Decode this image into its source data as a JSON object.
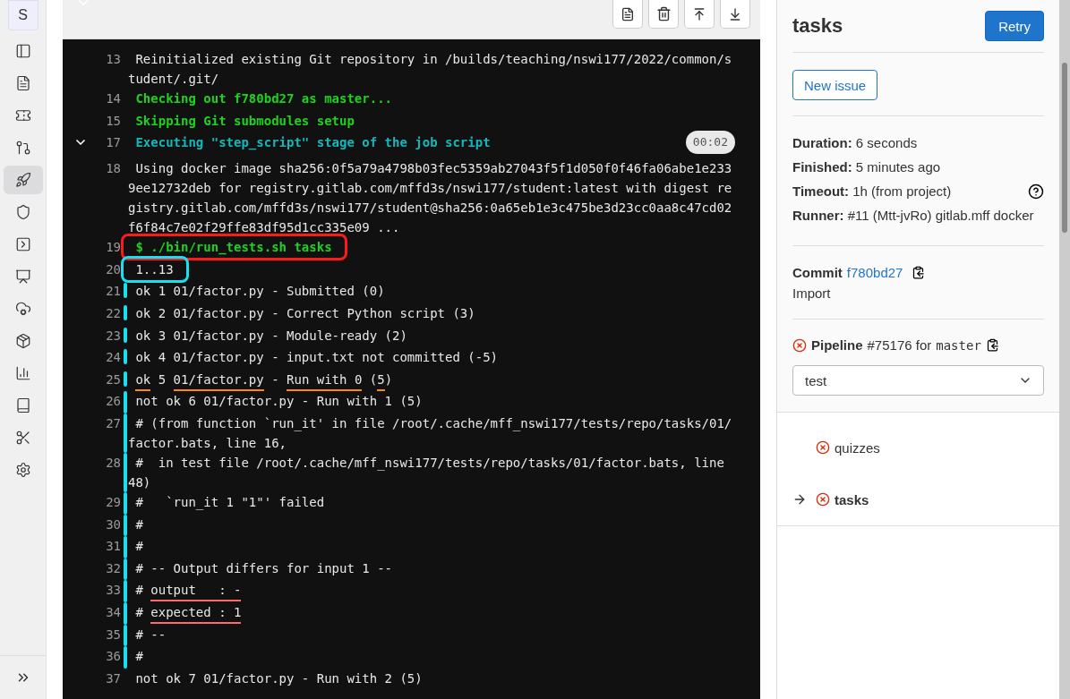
{
  "sidebar": {
    "avatar": "S",
    "items": [
      {
        "selected": false
      },
      {
        "selected": false
      },
      {
        "selected": false
      },
      {
        "selected": false
      },
      {
        "selected": true
      },
      {
        "selected": false
      },
      {
        "selected": false
      },
      {
        "selected": false
      },
      {
        "selected": false
      },
      {
        "selected": false
      },
      {
        "selected": false
      },
      {
        "selected": false
      },
      {
        "selected": false
      },
      {
        "selected": false
      }
    ]
  },
  "log": {
    "lines": [
      {
        "num": "13",
        "kind": "plain",
        "text": "Reinitialized existing Git repository in /builds/teaching/nswi177/2022/common/student/.git/"
      },
      {
        "num": "14",
        "kind": "info",
        "text": "Checking out f780bd27 as master..."
      },
      {
        "num": "15",
        "kind": "info",
        "text": "Skipping Git submodules setup"
      },
      {
        "num": "17",
        "kind": "section",
        "expanded": true,
        "duration": "00:02",
        "text": "Executing \"step_script\" stage of the job script"
      },
      {
        "num": "18",
        "kind": "plain",
        "text": "Using docker image sha256:0f5a79a4798b03fec5359ab27043f5f1d050f0f46fa06abe1e2339ee12732deb for registry.gitlab.com/mffd3s/nswi177/student:latest with digest registry.gitlab.com/mffd3s/nswi177/student@sha256:0a65eb1e3c475be3d23cc0aa8c47cd02f6f84c7e02f29ffe83df95d1cc335e09 ..."
      },
      {
        "num": "19",
        "kind": "info",
        "color": "#ff1a1a",
        "text": "$ ./bin/run_tests.sh tasks"
      },
      {
        "num": "20",
        "kind": "plain",
        "color": "#19e0f0",
        "text": "1..13"
      },
      {
        "num": "21",
        "kind": "plain",
        "bar": true,
        "bar_joined": false,
        "text": "ok 1 01/factor.py - Submitted (0)"
      },
      {
        "num": "22",
        "kind": "plain",
        "bar": true,
        "bar_joined": false,
        "text": "ok 2 01/factor.py - Correct Python script (3)"
      },
      {
        "num": "23",
        "kind": "plain",
        "bar": true,
        "bar_joined": false,
        "text": "ok 3 01/factor.py - Module-ready (2)"
      },
      {
        "num": "24",
        "kind": "plain",
        "bar": true,
        "bar_joined": false,
        "text": "ok 4 01/factor.py - input.txt not committed (-5)"
      },
      {
        "num": "25",
        "kind": "plain",
        "bar": true,
        "bar_joined": false,
        "parts": [
          {
            "text": "ok",
            "underline": true,
            "color": "#ff8a00"
          },
          {
            "text": " 5 ",
            "underline": false
          },
          {
            "text": "01/factor.py",
            "underline": true,
            "color": "#ff8a00"
          },
          {
            "text": " - ",
            "underline": false
          },
          {
            "text": "Run with 0",
            "underline": true,
            "color": "#ff8a00"
          },
          {
            "text": " (",
            "underline": false
          },
          {
            "text": "5",
            "underline": true,
            "color": "#ff8a00"
          },
          {
            "text": ")",
            "underline": false
          }
        ]
      },
      {
        "num": "26",
        "kind": "plain",
        "bar": true,
        "bar_joined": true,
        "text": "not ok 6 01/factor.py - Run with 1 (5)"
      },
      {
        "num": "27",
        "kind": "plain",
        "bar": true,
        "bar_joined": true,
        "text": "# (from function `run_it' in file /root/.cache/mff_nswi177/tests/repo/tasks/01/factor.bats, line 16,"
      },
      {
        "num": "28",
        "kind": "plain",
        "bar": true,
        "bar_joined": true,
        "text": "#  in test file /root/.cache/mff_nswi177/tests/repo/tasks/01/factor.bats, line 48)"
      },
      {
        "num": "29",
        "kind": "plain",
        "bar": true,
        "bar_joined": true,
        "text": "#   `run_it 1 \"1\"' failed"
      },
      {
        "num": "30",
        "kind": "plain",
        "bar": true,
        "bar_joined": true,
        "text": "#"
      },
      {
        "num": "31",
        "kind": "plain",
        "bar": true,
        "bar_joined": true,
        "text": "#"
      },
      {
        "num": "32",
        "kind": "plain",
        "bar": true,
        "bar_joined": true,
        "text": "# -- Output differs for input 1 --"
      },
      {
        "num": "33",
        "kind": "plain",
        "bar": true,
        "bar_joined": true,
        "parts": [
          {
            "text": "# ",
            "underline": false
          },
          {
            "text": "output   : -",
            "underline": true,
            "color": "#ff6b6b"
          }
        ]
      },
      {
        "num": "34",
        "kind": "plain",
        "bar": true,
        "bar_joined": true,
        "parts": [
          {
            "text": "# ",
            "underline": false
          },
          {
            "text": "expected : 1",
            "underline": true,
            "color": "#ff6b6b"
          }
        ]
      },
      {
        "num": "35",
        "kind": "plain",
        "bar": true,
        "bar_joined": true,
        "text": "# --"
      },
      {
        "num": "36",
        "kind": "plain",
        "bar": true,
        "bar_joined": true,
        "text": "#"
      },
      {
        "num": "37",
        "kind": "plain",
        "text": "not ok 7 01/factor.py - Run with 2 (5)"
      }
    ]
  },
  "job": {
    "title": "tasks",
    "retry": "Retry",
    "new_issue": "New issue",
    "details": [
      "**Duration:** 6 seconds",
      "**Finished:** 5 minutes ago",
      "**Timeout:** 1h (from project)",
      "**Runner:** #11 (Mtt-jvRo) gitlab.mff docker"
    ],
    "commit": {
      "label": "Commit",
      "sha": "f780bd27",
      "message": "Import"
    },
    "pipeline": {
      "failed": true,
      "label": "Pipeline",
      "text": "#75176 for",
      "ref": "master"
    },
    "stage": {
      "value": "test"
    },
    "jobs": [
      {
        "name": "quizzes",
        "failed": true,
        "selected": false
      },
      {
        "name": "tasks",
        "failed": true,
        "selected": true
      }
    ]
  }
}
